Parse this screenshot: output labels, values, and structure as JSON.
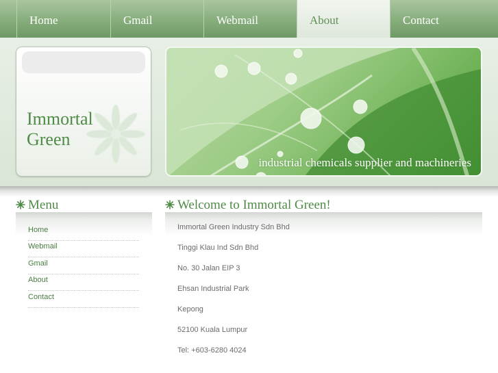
{
  "nav": {
    "items": [
      {
        "label": "Home"
      },
      {
        "label": "Gmail"
      },
      {
        "label": "Webmail"
      },
      {
        "label": "About"
      },
      {
        "label": "Contact"
      }
    ],
    "active": "About"
  },
  "logo": {
    "line1": "Immortal",
    "line2": "Green"
  },
  "banner": {
    "caption": "industrial chemicals supplier and machineries"
  },
  "menu": {
    "title": "Menu",
    "items": [
      {
        "label": "Home"
      },
      {
        "label": "Webmail"
      },
      {
        "label": "Gmail"
      },
      {
        "label": "About"
      },
      {
        "label": "Contact"
      }
    ]
  },
  "content": {
    "title": "Welcome to Immortal Green!",
    "lines": [
      "Immortal Green Industry Sdn Bhd",
      "Tinggi Klau Ind Sdn Bhd",
      "No. 30 Jalan EIP 3",
      "Ehsan Industrial Park",
      "Kepong",
      "52100 Kuala Lumpur",
      "Tel: +603-6280 4024"
    ]
  },
  "colors": {
    "brand_green": "#4f8a46",
    "nav_green": "#86ad7c",
    "text_gray": "#6b6b6b"
  }
}
